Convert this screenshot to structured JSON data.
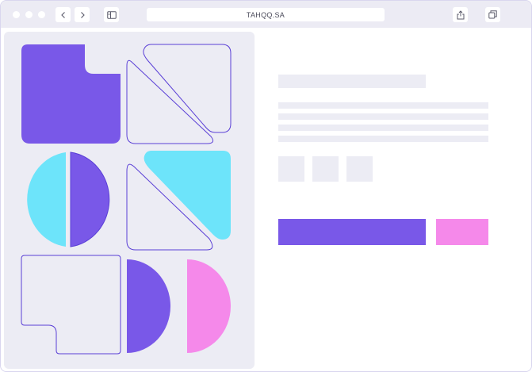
{
  "browser": {
    "url": "TAHQQ.SA",
    "window_dots": [
      "close",
      "minimize",
      "maximize"
    ],
    "icons": [
      "back-arrow-icon",
      "forward-arrow-icon",
      "sidebar-icon",
      "share-icon",
      "tabs-icon"
    ]
  },
  "colors": {
    "chrome": "#ecebf4",
    "panel": "#ececf4",
    "purple": "#7958e8",
    "cyan": "#6de4fa",
    "pink": "#f589ea",
    "outline": "#5a3fd6",
    "skeleton": "#ececf4"
  },
  "content": {
    "primary_button_color": "#7958e8",
    "secondary_button_color": "#f589ea"
  }
}
